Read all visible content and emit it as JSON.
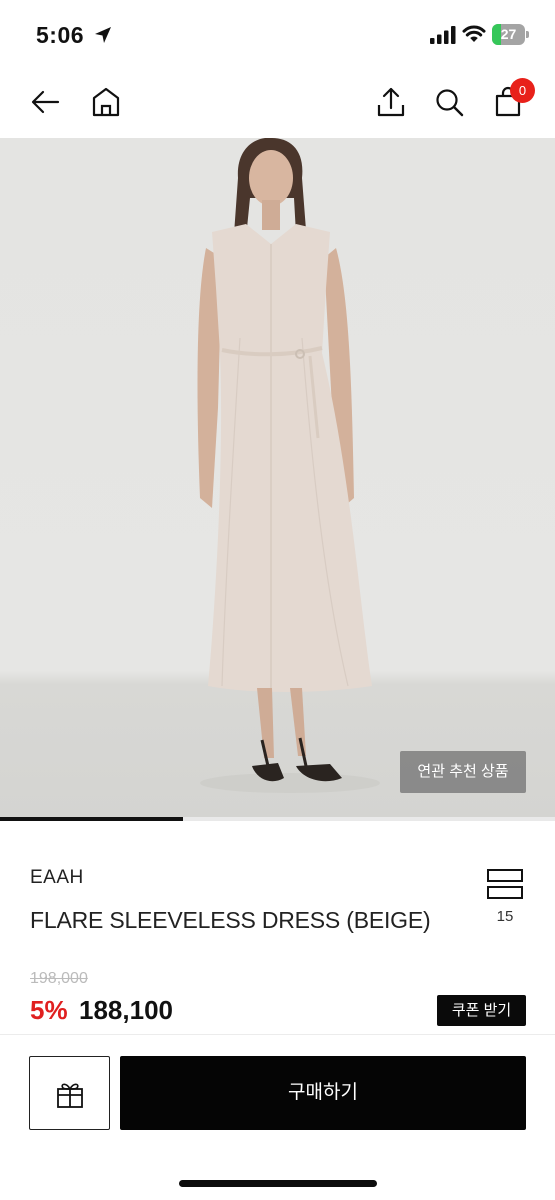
{
  "status_bar": {
    "time": "5:06",
    "battery": "27",
    "battery_level": 0.27,
    "icons": [
      "location-arrow-icon",
      "signal-icon",
      "wifi-icon",
      "battery-icon"
    ]
  },
  "nav": {
    "icons": [
      "back-arrow-icon",
      "home-icon",
      "share-icon",
      "search-icon",
      "shopping-bag-icon"
    ],
    "cart_count": "0"
  },
  "gallery": {
    "related_label": "연관 추천 상품",
    "slide_progress": 0.33
  },
  "product": {
    "brand": "EAAH",
    "name": "FLARE SLEEVELESS DRESS (BEIGE)",
    "compare_count": "15",
    "original_price": "198,000",
    "discount": "5%",
    "price": "188,100",
    "coupon_label": "쿠폰 받기"
  },
  "bottom_bar": {
    "gift_icon": "gift-icon",
    "buy_label": "구매하기"
  },
  "colors": {
    "accent_red": "#e8211a",
    "discount_red": "#e02020",
    "button_black": "#050505"
  }
}
